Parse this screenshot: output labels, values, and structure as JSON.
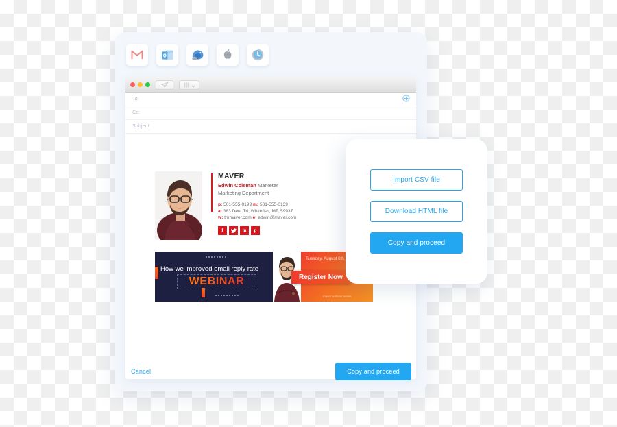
{
  "mail_clients": [
    {
      "name": "gmail-icon",
      "label": "Gmail"
    },
    {
      "name": "outlook-icon",
      "label": "Outlook"
    },
    {
      "name": "thunderbird-icon",
      "label": "Thunderbird"
    },
    {
      "name": "apple-mail-icon",
      "label": "Apple Mail"
    },
    {
      "name": "zoho-mail-icon",
      "label": "Zoho Mail"
    }
  ],
  "compose": {
    "toolbar": {
      "send_icon": "paper-plane-icon",
      "layout_icon": "columns-dropdown-icon"
    },
    "fields": [
      {
        "label": "To:",
        "value": ""
      },
      {
        "label": "Cc:",
        "value": ""
      },
      {
        "label": "Subject:",
        "value": ""
      }
    ],
    "add_recipient_icon": "plus-circle-icon"
  },
  "signature": {
    "company": "MAVER",
    "name": "Edwin Coleman",
    "role": "Marketer",
    "department": "Marketing Department",
    "phone_label": "p:",
    "phone": "501-555-0199",
    "mobile_label": "m:",
    "mobile": "501-555-0139",
    "address_label": "a:",
    "address": "383 Deer Trl, Whitefish, MT, 59937",
    "web_label": "w:",
    "web": "tmmaver.com",
    "email_label": "e:",
    "email": "edwin@maver.com",
    "social": [
      {
        "name": "facebook-icon",
        "glyph": "f"
      },
      {
        "name": "twitter-icon",
        "glyph": "t"
      },
      {
        "name": "linkedin-icon",
        "glyph": "in"
      },
      {
        "name": "pinterest-icon",
        "glyph": "p"
      }
    ],
    "accent_color": "#cf2027"
  },
  "banner": {
    "headline": "How we improved email reply rate",
    "title": "WEBINAR",
    "date": "Tuesday, August 6th",
    "cta": "Register Now",
    "footnote": "maver webinar series",
    "bg_color": "#1d2040",
    "accent_color": "#f05a22"
  },
  "footer": {
    "cancel_label": "Cancel",
    "primary_label": "Copy and proceed"
  },
  "popup": {
    "import_csv_label": "Import CSV file",
    "download_html_label": "Download HTML file",
    "copy_proceed_label": "Copy and proceed",
    "accent_color": "#22a7f0"
  }
}
